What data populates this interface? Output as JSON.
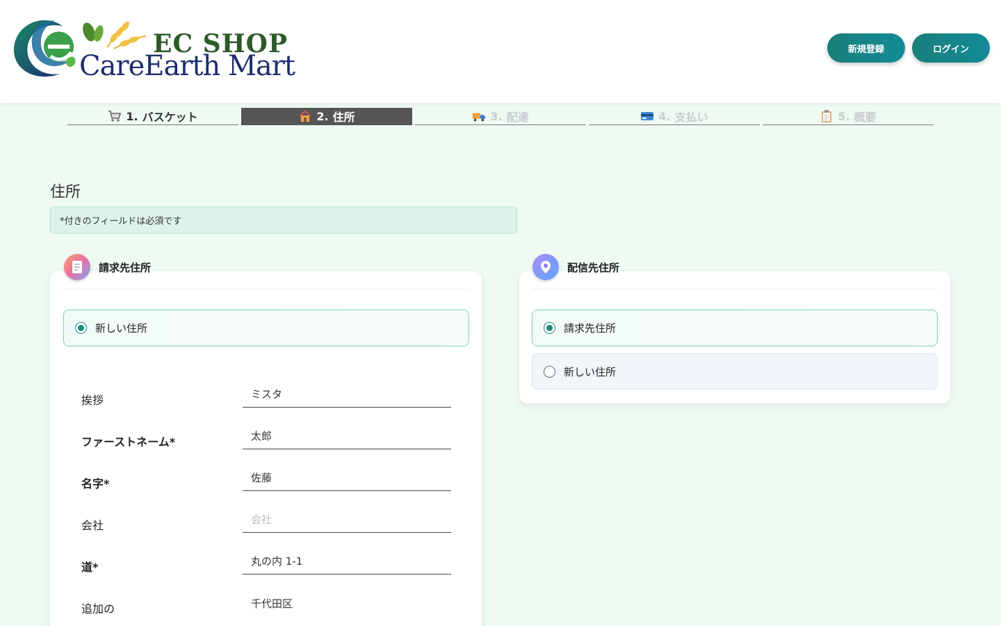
{
  "header": {
    "logo_line1": "EC SHOP",
    "logo_line2": "CareEarth Mart",
    "register_label": "新規登録",
    "login_label": "ログイン"
  },
  "steps": [
    {
      "number": "1.",
      "label": "バスケット",
      "icon": "cart-icon",
      "state": "done"
    },
    {
      "number": "2.",
      "label": "住所",
      "icon": "house-icon",
      "state": "active"
    },
    {
      "number": "3.",
      "label": "配達",
      "icon": "truck-icon",
      "state": "disabled"
    },
    {
      "number": "4.",
      "label": "支払い",
      "icon": "credit-card-icon",
      "state": "disabled"
    },
    {
      "number": "5.",
      "label": "概要",
      "icon": "clipboard-icon",
      "state": "disabled"
    }
  ],
  "page_title": "住所",
  "notice": "*付きのフィールドは必須です",
  "billing": {
    "title": "請求先住所",
    "icon": "document-icon",
    "option_new": "新しい住所",
    "fields": [
      {
        "label": "挨拶",
        "value": "ミスタ",
        "placeholder": "",
        "required": false
      },
      {
        "label": "ファーストネーム*",
        "value": "太郎",
        "placeholder": "",
        "required": true
      },
      {
        "label": "名字*",
        "value": "佐藤",
        "placeholder": "",
        "required": true
      },
      {
        "label": "会社",
        "value": "",
        "placeholder": "会社",
        "required": false
      },
      {
        "label": "道*",
        "value": "丸の内 1-1",
        "placeholder": "",
        "required": true
      },
      {
        "label": "追加の",
        "value": "千代田区",
        "placeholder": "",
        "required": false
      }
    ]
  },
  "shipping": {
    "title": "配信先住所",
    "icon": "location-pin-icon",
    "option_billing": "請求先住所",
    "option_new": "新しい住所"
  }
}
